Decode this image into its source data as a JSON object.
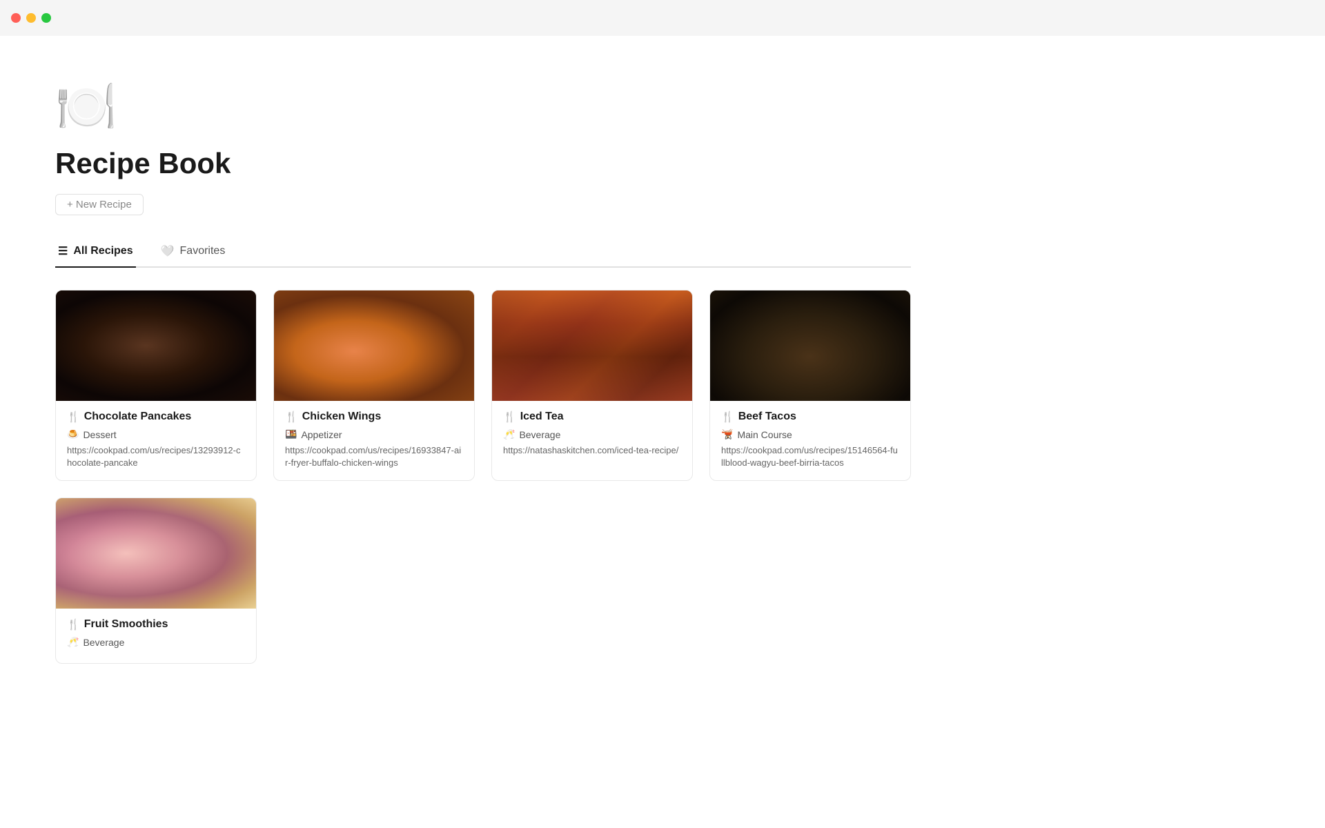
{
  "titlebar": {
    "traffic_lights": [
      "red",
      "yellow",
      "green"
    ]
  },
  "page": {
    "icon": "🍽️",
    "title": "Recipe Book",
    "new_recipe_label": "+ New Recipe"
  },
  "tabs": [
    {
      "id": "all-recipes",
      "label": "All Recipes",
      "icon": "☰",
      "active": true
    },
    {
      "id": "favorites",
      "label": "Favorites",
      "icon": "🤍",
      "active": false
    }
  ],
  "recipes": [
    {
      "id": "chocolate-pancakes",
      "name": "Chocolate Pancakes",
      "name_icon": "🍴",
      "category": "Dessert",
      "category_icon": "🍮",
      "url": "https://cookpad.com/us/recipes/13293912-chocolate-pancake",
      "image_class": "img-chocolate"
    },
    {
      "id": "chicken-wings",
      "name": "Chicken Wings",
      "name_icon": "🍴",
      "category": "Appetizer",
      "category_icon": "🍱",
      "url": "https://cookpad.com/us/recipes/16933847-air-fryer-buffalo-chicken-wings",
      "image_class": "img-chicken"
    },
    {
      "id": "iced-tea",
      "name": "Iced Tea",
      "name_icon": "🍴",
      "category": "Beverage",
      "category_icon": "🥂",
      "url": "https://natashaskitchen.com/iced-tea-recipe/",
      "image_class": "img-icedtea"
    },
    {
      "id": "beef-tacos",
      "name": "Beef Tacos",
      "name_icon": "🍴",
      "category": "Main Course",
      "category_icon": "🫕",
      "url": "https://cookpad.com/us/recipes/15146564-fullblood-wagyu-beef-birria-tacos",
      "image_class": "img-beeftacos"
    },
    {
      "id": "fruit-smoothies",
      "name": "Fruit Smoothies",
      "name_icon": "🍴",
      "category": "Beverage",
      "category_icon": "🥂",
      "url": "",
      "image_class": "img-smoothie"
    }
  ]
}
